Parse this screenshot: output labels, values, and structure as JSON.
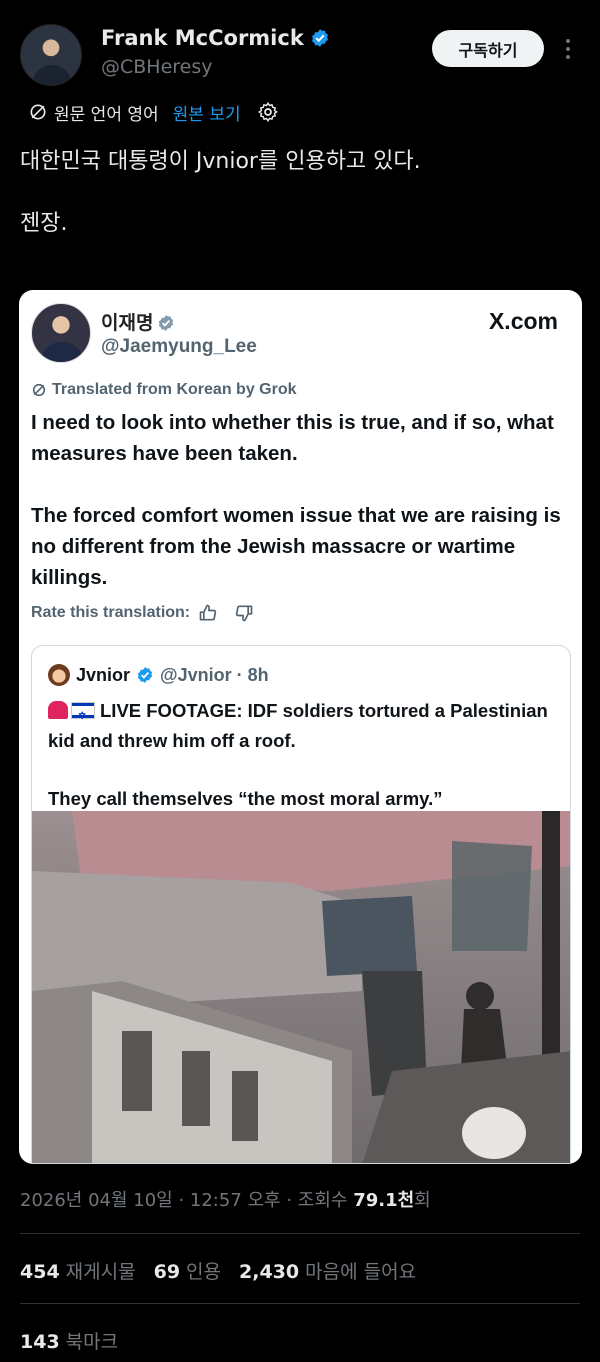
{
  "author": {
    "name": "Frank McCormick",
    "handle": "@CBHeresy",
    "subscribe_label": "구독하기"
  },
  "translation_bar": {
    "language_note": "원문 언어 영어",
    "show_original": "원본 보기"
  },
  "tweet": {
    "line1": "대한민국 대통령이 Jvnior를 인용하고 있다.",
    "line2": "젠장."
  },
  "card": {
    "name": "이재명",
    "handle": "@Jaemyung_Lee",
    "site": "X.com",
    "translated_note": "Translated from Korean by Grok",
    "paragraph1": "I need to look into whether this is true, and if so, what measures have been taken.",
    "paragraph2": "The forced comfort women issue that we are raising is no different from the Jewish massacre or wartime killings.",
    "rate_label": "Rate this translation:",
    "quote": {
      "name": "Jvnior",
      "handle_time": "@Jvnior · 8h",
      "line1": "LIVE FOOTAGE: IDF soldiers tortured a Palestinian kid and threw him off a roof.",
      "line2": "They call themselves “the most moral army.”"
    }
  },
  "meta": {
    "timestamp": "2026년 04월 10일 · 12:57 오후 · 조회수 ",
    "views": "79.1천",
    "views_suffix": "회"
  },
  "stats": {
    "reposts_count": "454",
    "reposts_label": "재게시물",
    "quotes_count": "69",
    "quotes_label": "인용",
    "likes_count": "2,430",
    "likes_label": "마음에 들어요"
  },
  "bookmarks": {
    "count": "143",
    "label": "북마크"
  },
  "colors": {
    "accent": "#1d9bf0",
    "background": "#000000",
    "muted": "#71767b"
  }
}
